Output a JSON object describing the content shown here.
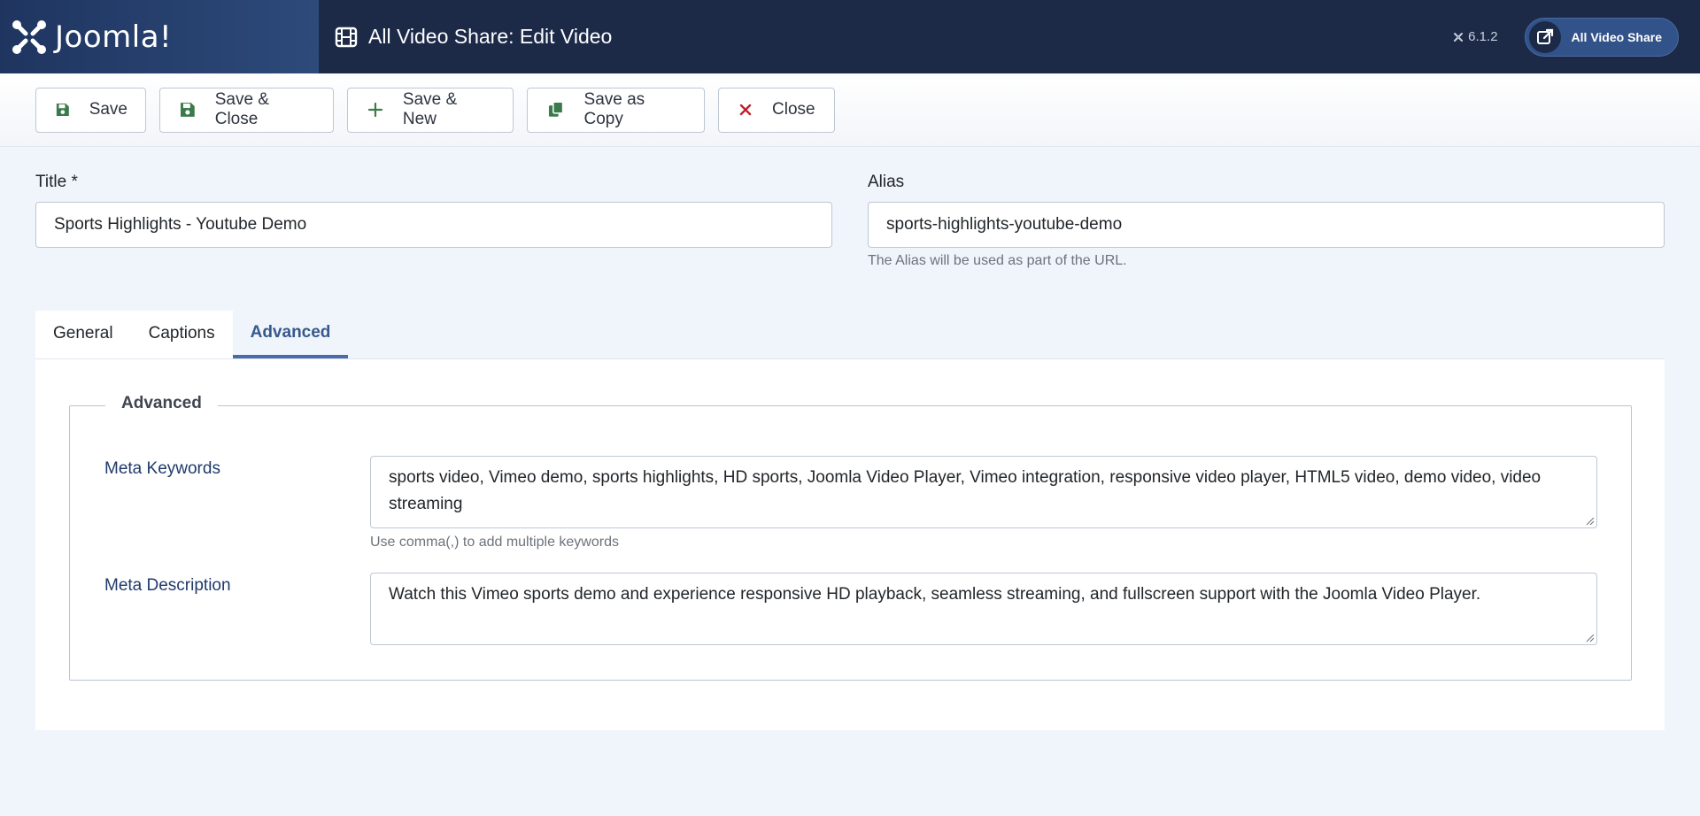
{
  "header": {
    "brand": "Joomla!",
    "page_title": "All Video Share: Edit Video",
    "version": "6.1.2",
    "site_button": "All Video Share"
  },
  "toolbar": {
    "save": "Save",
    "save_close": "Save & Close",
    "save_new": "Save & New",
    "save_copy": "Save as Copy",
    "close": "Close"
  },
  "form": {
    "title_label": "Title *",
    "title_value": "Sports Highlights - Youtube Demo",
    "alias_label": "Alias",
    "alias_value": "sports-highlights-youtube-demo",
    "alias_help": "The Alias will be used as part of the URL."
  },
  "tabs": [
    {
      "label": "General"
    },
    {
      "label": "Captions"
    },
    {
      "label": "Advanced"
    }
  ],
  "advanced": {
    "legend": "Advanced",
    "meta_keywords_label": "Meta Keywords",
    "meta_keywords_value": "sports video, Vimeo demo, sports highlights, HD sports, Joomla Video Player, Vimeo integration, responsive video player, HTML5 video, demo video, video streaming",
    "meta_keywords_help": "Use comma(,) to add multiple keywords",
    "meta_description_label": "Meta Description",
    "meta_description_value": "Watch this Vimeo sports demo and experience responsive HD playback, seamless streaming, and fullscreen support with the Joomla Video Player."
  },
  "colors": {
    "header_bg": "#1c2a48",
    "accent": "#4a6ca6",
    "save_icon": "#3b7a4a",
    "close_icon": "#c0202a"
  }
}
